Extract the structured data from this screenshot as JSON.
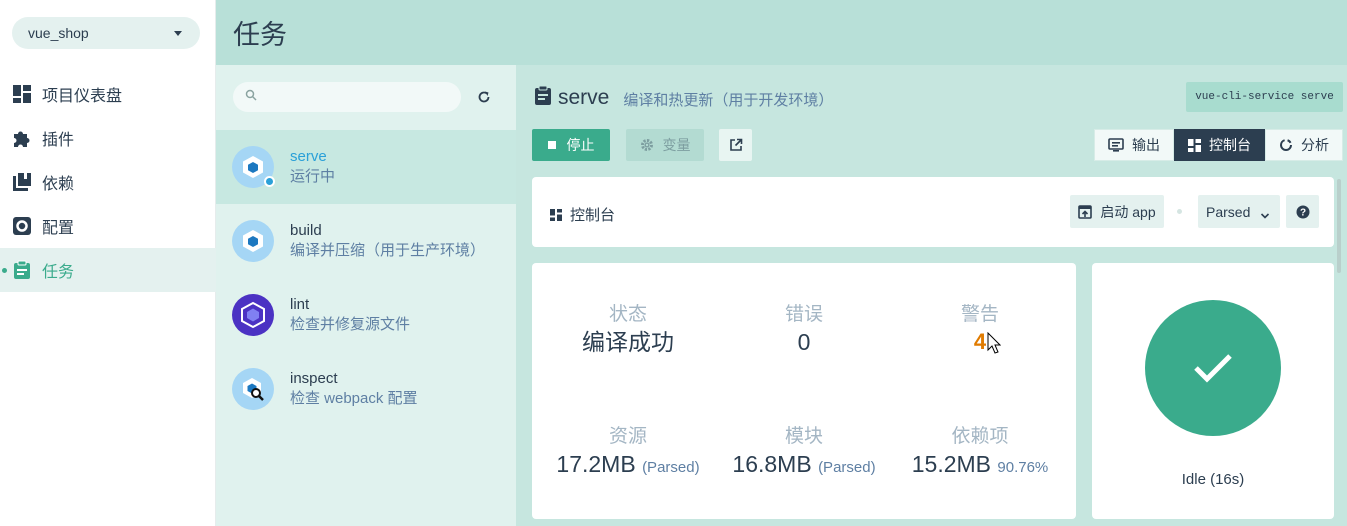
{
  "nav": {
    "project": "vue_shop",
    "items": [
      {
        "label": "项目仪表盘",
        "icon": "dashboard-icon"
      },
      {
        "label": "插件",
        "icon": "puzzle-icon"
      },
      {
        "label": "依赖",
        "icon": "library-icon"
      },
      {
        "label": "配置",
        "icon": "gear-icon"
      },
      {
        "label": "任务",
        "icon": "clipboard-icon",
        "active": true
      }
    ]
  },
  "header": {
    "title": "任务"
  },
  "tasks": {
    "search_placeholder": "",
    "items": [
      {
        "name": "serve",
        "desc": "运行中",
        "icon": "webpack-icon",
        "active": true
      },
      {
        "name": "build",
        "desc": "编译并压缩（用于生产环境）",
        "icon": "webpack-icon"
      },
      {
        "name": "lint",
        "desc": "检查并修复源文件",
        "icon": "eslint-icon"
      },
      {
        "name": "inspect",
        "desc": "检查 webpack 配置",
        "icon": "webpack-inspect-icon"
      }
    ]
  },
  "detail": {
    "name": "serve",
    "desc": "编译和热更新（用于开发环境）",
    "command": "vue-cli-service serve",
    "stop_label": "停止",
    "vars_label": "变量",
    "tabs": [
      {
        "label": "输出",
        "icon": "terminal-icon"
      },
      {
        "label": "控制台",
        "icon": "dashboard-icon",
        "active": true
      },
      {
        "label": "分析",
        "icon": "donut-icon"
      }
    ]
  },
  "dashboard": {
    "title": "控制台",
    "launch_label": "启动 app",
    "mode": "Parsed",
    "stats": {
      "status_label": "状态",
      "status_value": "编译成功",
      "errors_label": "错误",
      "errors_value": "0",
      "warnings_label": "警告",
      "warnings_value": "4",
      "assets_label": "资源",
      "assets_value": "17.2MB",
      "assets_unit": "(Parsed)",
      "modules_label": "模块",
      "modules_value": "16.8MB",
      "modules_unit": "(Parsed)",
      "deps_label": "依赖项",
      "deps_value": "15.2MB",
      "deps_pct": "90.76%"
    },
    "state": "Idle (16s)"
  },
  "colors": {
    "accent": "#3aab8c",
    "header": "#b8e0d8",
    "warning": "#e07b00",
    "running": "#2aa0d8"
  }
}
